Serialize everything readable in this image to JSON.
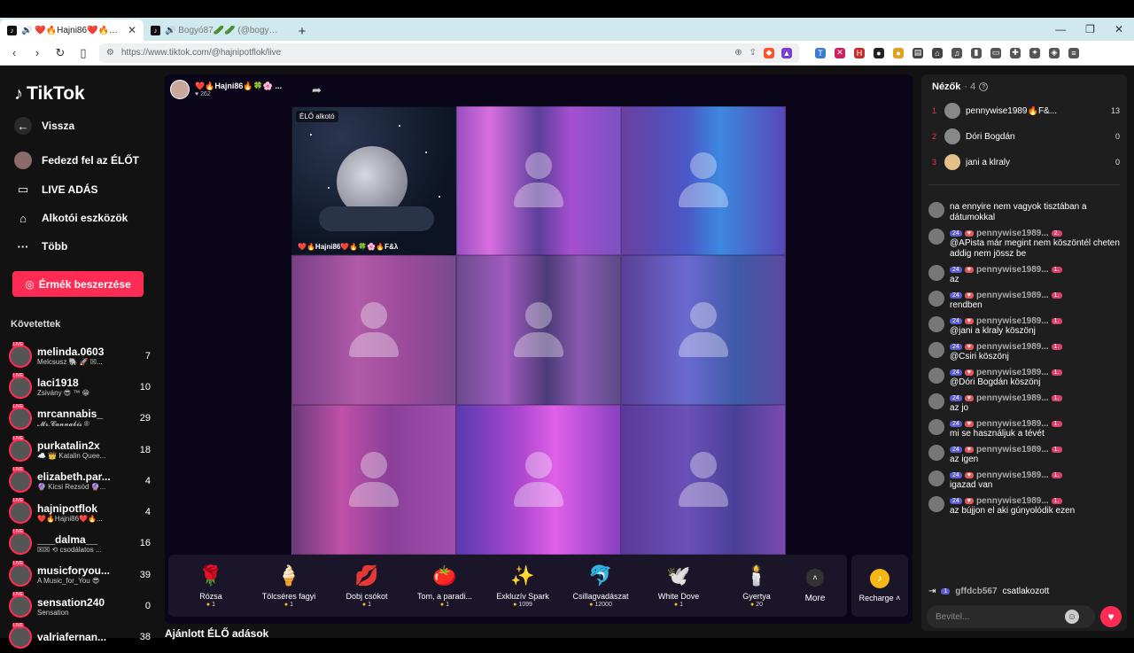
{
  "browser": {
    "tabs": [
      {
        "title": "🔊 ❤️🔥Hajni86❤️🔥🍀🌸🔥F&",
        "active": true
      },
      {
        "title": "🔊 Bogyó87🥒🥒 (@bogyo87_) É",
        "active": false
      }
    ],
    "url": "https://www.tiktok.com/@hajnipotflok/live"
  },
  "sidebar": {
    "logo": "TikTok",
    "nav": [
      {
        "label": "Vissza",
        "icon": "back-arrow-icon"
      },
      {
        "label": "Fedezd fel az ÉLŐT",
        "icon": "avatar-icon"
      },
      {
        "label": "LIVE ADÁS",
        "icon": "camera-icon"
      },
      {
        "label": "Alkotói eszközök",
        "icon": "creator-tools-icon"
      },
      {
        "label": "Több",
        "icon": "more-dots-icon"
      }
    ],
    "coins_button": "Érmék beszerzése",
    "following_title": "Követettek",
    "following": [
      {
        "name": "melinda.0603",
        "sub": "Melcsusz 🐘 🚀 ☒...",
        "count": "7"
      },
      {
        "name": "laci1918",
        "sub": "Zsivány 😎 ™ 😁",
        "count": "10"
      },
      {
        "name": "mrcannabis_",
        "sub": "𝓜𝓻.𝓒𝓪𝓷𝓷𝓪𝓫𝓲𝓼 ®",
        "count": "29"
      },
      {
        "name": "purkatalin2x",
        "sub": "☁️ 👑 Katalin Quee...",
        "count": "18"
      },
      {
        "name": "elizabeth.par...",
        "sub": "🔮 Kicsi Rezsód 🔮...",
        "count": "4"
      },
      {
        "name": "hajnipotflok",
        "sub": "❤️🔥Hajni86❤️🔥...",
        "count": "4"
      },
      {
        "name": "___dalma__",
        "sub": "☒☒ ⟲ csodálatos ...",
        "count": "16"
      },
      {
        "name": "musicforyou...",
        "sub": "A Music_for_You 😎",
        "count": "39"
      },
      {
        "name": "sensation240",
        "sub": "Sensation",
        "count": "0"
      },
      {
        "name": "valriafernan...",
        "sub": "",
        "count": "38"
      }
    ]
  },
  "stream": {
    "host_name": "❤️🔥Hajni86🔥🍀🌸 ...",
    "host_viewers": "262",
    "live_label": "ÉLŐ alkotó",
    "host_tag": "❤️🔥Hajni86❤️🔥🍀🌸🔥F&λ",
    "gifts": [
      {
        "name": "Rózsa",
        "price": "1",
        "icon": "🌹"
      },
      {
        "name": "Tölcséres fagyi",
        "price": "1",
        "icon": "🍦"
      },
      {
        "name": "Dobj csókot",
        "price": "1",
        "icon": "💋"
      },
      {
        "name": "Tom, a paradi...",
        "price": "1",
        "icon": "🍅"
      },
      {
        "name": "Exkluzív Spark",
        "price": "1099",
        "icon": "✨"
      },
      {
        "name": "Csillagvadászat",
        "price": "12000",
        "icon": "🐬"
      },
      {
        "name": "White Dove",
        "price": "1",
        "icon": "🕊️"
      },
      {
        "name": "Gyertya",
        "price": "20",
        "icon": "🕯️"
      }
    ],
    "more_label": "More",
    "recharge_label": "Recharge",
    "recommended_title": "Ajánlott ÉLŐ adások"
  },
  "viewers": {
    "title": "Nézők",
    "count": "· 4",
    "list": [
      {
        "rank": "1",
        "name": "pennywise1989🔥F&...",
        "score": "13"
      },
      {
        "rank": "2",
        "name": "Dóri Bogdán",
        "score": "0"
      },
      {
        "rank": "3",
        "name": "jani a klraly",
        "score": "0"
      }
    ]
  },
  "chat": {
    "messages": [
      {
        "name": "",
        "level": "",
        "fan": "",
        "text": "na ennyire nem vagyok tisztában a dátumokkal"
      },
      {
        "name": "pennywise1989...",
        "level": "24",
        "fan": "2.",
        "text": "@APista már megint nem köszöntél cheten addig nem jössz be"
      },
      {
        "name": "pennywise1989...",
        "level": "24",
        "fan": "1.",
        "text": "az"
      },
      {
        "name": "pennywise1989...",
        "level": "24",
        "fan": "1.",
        "text": "rendben"
      },
      {
        "name": "pennywise1989...",
        "level": "24",
        "fan": "1.",
        "text": "@jani a klraly köszönj"
      },
      {
        "name": "pennywise1989...",
        "level": "24",
        "fan": "1.",
        "text": "@Csiri köszönj"
      },
      {
        "name": "pennywise1989...",
        "level": "24",
        "fan": "1.",
        "text": "@Dóri Bogdán köszönj"
      },
      {
        "name": "pennywise1989...",
        "level": "24",
        "fan": "1.",
        "text": "az jo"
      },
      {
        "name": "pennywise1989...",
        "level": "24",
        "fan": "1.",
        "text": "mi se használjuk a tévét"
      },
      {
        "name": "pennywise1989...",
        "level": "24",
        "fan": "1.",
        "text": "az igen"
      },
      {
        "name": "pennywise1989...",
        "level": "24",
        "fan": "1.",
        "text": "igazad van"
      },
      {
        "name": "pennywise1989...",
        "level": "24",
        "fan": "1.",
        "text": "az bújjon el aki gúnyolódik ezen"
      }
    ],
    "joined_level": "1",
    "joined_user": "gffdcb567",
    "joined_text": "csatlakozott",
    "input_placeholder": "Bevitel..."
  }
}
